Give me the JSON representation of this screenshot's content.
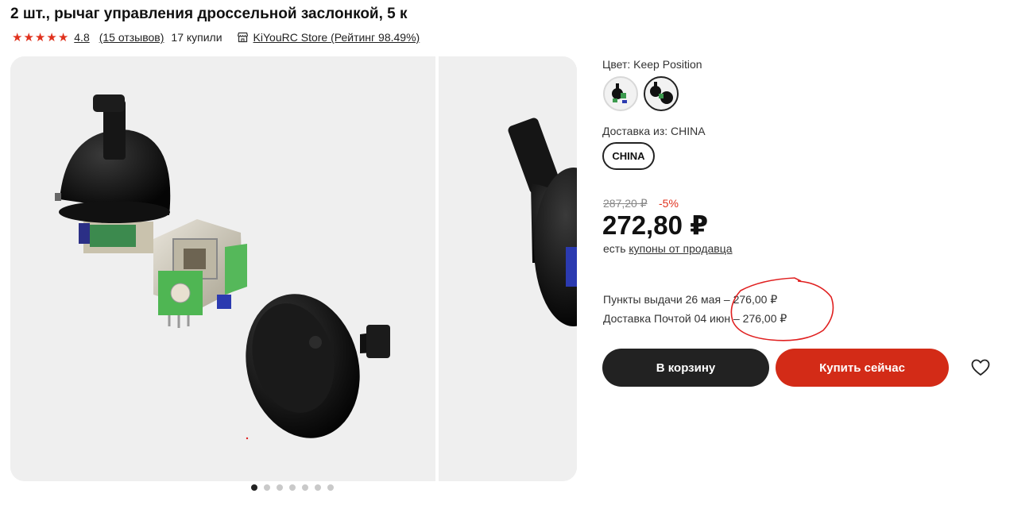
{
  "product": {
    "title": "2 шт., рычаг управления дроссельной заслонкой, 5 к",
    "rating": "4.8",
    "reviews": "(15 отзывов)",
    "bought": "17 купили",
    "store": "KiYouRC Store (Рейтинг 98.49%)",
    "stars": 5
  },
  "options": {
    "color_label": "Цвет: Keep Position",
    "ship_from_label": "Доставка из: CHINA",
    "ship_chip": "CHINA"
  },
  "pricing": {
    "old_price": "287,20 ₽",
    "discount": "-5%",
    "price": "272,80 ₽",
    "coupons_prefix": "есть",
    "coupons_link": "купоны от продавца"
  },
  "delivery": {
    "pickup": "Пункты выдачи 26 мая – 276,00 ₽",
    "post": "Доставка Почтой 04 июн – 276,00 ₽"
  },
  "actions": {
    "cart": "В корзину",
    "buy": "Купить сейчас"
  },
  "gallery": {
    "total_slides": 7,
    "active_slide": 1
  },
  "colors": {
    "accent_red": "#d32b17",
    "star_red": "#e0311d",
    "dark": "#222222",
    "annotation_red": "#e02020"
  }
}
